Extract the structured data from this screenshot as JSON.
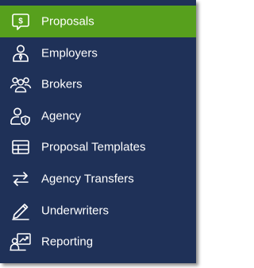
{
  "menu": {
    "items": [
      {
        "label": "Proposals",
        "icon": "proposal-icon",
        "active": true
      },
      {
        "label": "Employers",
        "icon": "employer-icon",
        "active": false
      },
      {
        "label": "Brokers",
        "icon": "brokers-icon",
        "active": false
      },
      {
        "label": "Agency",
        "icon": "agency-icon",
        "active": false
      },
      {
        "label": "Proposal Templates",
        "icon": "template-table-icon",
        "active": false
      },
      {
        "label": "Agency Transfers",
        "icon": "transfer-arrows-icon",
        "active": false
      },
      {
        "label": "Underwriters",
        "icon": "pencil-icon",
        "active": false
      },
      {
        "label": "Reporting",
        "icon": "reporting-icon",
        "active": false
      }
    ]
  },
  "colors": {
    "background": "#1f3158",
    "active": "#57a01d",
    "text": "#ffffff"
  }
}
